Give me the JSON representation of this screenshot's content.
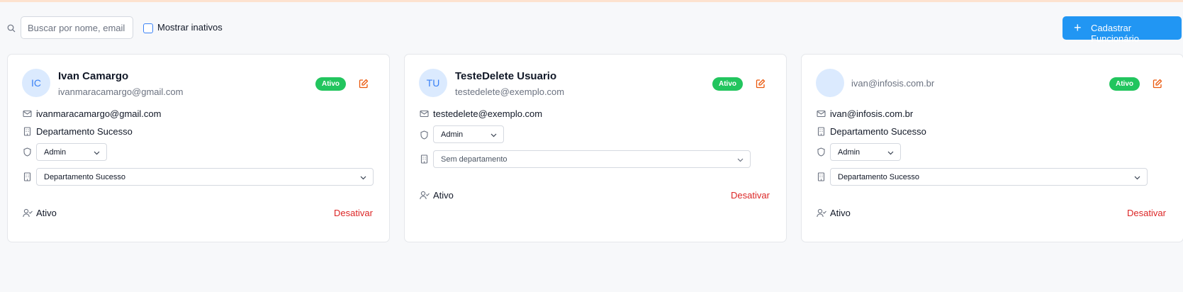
{
  "toolbar": {
    "search_placeholder": "Buscar por nome, email ou",
    "show_inactive_label": "Mostrar inativos",
    "add_button_label": "Cadastrar Funcionário",
    "add_button_icon": "plus-icon"
  },
  "colors": {
    "primary": "#2196f3",
    "active_badge": "#22c55e",
    "edit_icon": "#ea580c",
    "deactivate": "#dc2626",
    "avatar_bg": "#dbeafe"
  },
  "employees": [
    {
      "initials": "IC",
      "name": "Ivan Camargo",
      "email_sub": "ivanmaracamargo@gmail.com",
      "badge": "Ativo",
      "email": "ivanmaracamargo@gmail.com",
      "department_text": "Departamento Sucesso",
      "role_select": "Admin",
      "department_select": "Departamento Sucesso",
      "status": "Ativo",
      "action": "Desativar"
    },
    {
      "initials": "TU",
      "name": "TesteDelete Usuario",
      "email_sub": "testedelete@exemplo.com",
      "badge": "Ativo",
      "email": "testedelete@exemplo.com",
      "role_select": "Admin",
      "department_select": "Sem departamento",
      "status": "Ativo",
      "action": "Desativar"
    },
    {
      "initials": "",
      "email_sub": "ivan@infosis.com.br",
      "badge": "Ativo",
      "email": "ivan@infosis.com.br",
      "department_text": "Departamento Sucesso",
      "role_select": "Admin",
      "department_select": "Departamento Sucesso",
      "status": "Ativo",
      "action": "Desativar"
    }
  ]
}
